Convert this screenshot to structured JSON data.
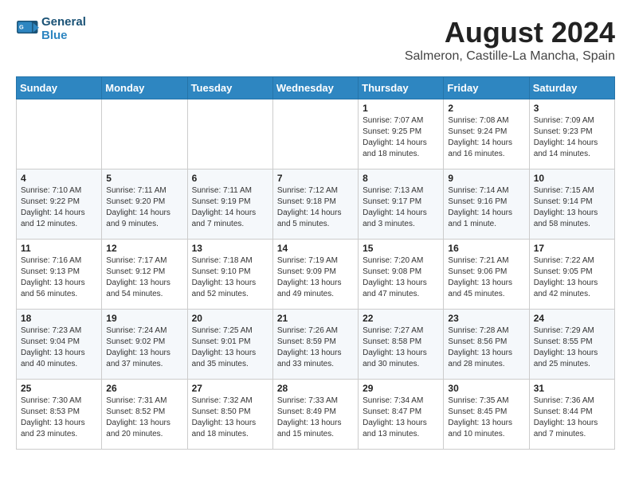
{
  "header": {
    "logo_line1": "General",
    "logo_line2": "Blue",
    "title": "August 2024",
    "subtitle": "Salmeron, Castille-La Mancha, Spain"
  },
  "weekdays": [
    "Sunday",
    "Monday",
    "Tuesday",
    "Wednesday",
    "Thursday",
    "Friday",
    "Saturday"
  ],
  "weeks": [
    [
      {
        "day": "",
        "info": ""
      },
      {
        "day": "",
        "info": ""
      },
      {
        "day": "",
        "info": ""
      },
      {
        "day": "",
        "info": ""
      },
      {
        "day": "1",
        "info": "Sunrise: 7:07 AM\nSunset: 9:25 PM\nDaylight: 14 hours\nand 18 minutes."
      },
      {
        "day": "2",
        "info": "Sunrise: 7:08 AM\nSunset: 9:24 PM\nDaylight: 14 hours\nand 16 minutes."
      },
      {
        "day": "3",
        "info": "Sunrise: 7:09 AM\nSunset: 9:23 PM\nDaylight: 14 hours\nand 14 minutes."
      }
    ],
    [
      {
        "day": "4",
        "info": "Sunrise: 7:10 AM\nSunset: 9:22 PM\nDaylight: 14 hours\nand 12 minutes."
      },
      {
        "day": "5",
        "info": "Sunrise: 7:11 AM\nSunset: 9:20 PM\nDaylight: 14 hours\nand 9 minutes."
      },
      {
        "day": "6",
        "info": "Sunrise: 7:11 AM\nSunset: 9:19 PM\nDaylight: 14 hours\nand 7 minutes."
      },
      {
        "day": "7",
        "info": "Sunrise: 7:12 AM\nSunset: 9:18 PM\nDaylight: 14 hours\nand 5 minutes."
      },
      {
        "day": "8",
        "info": "Sunrise: 7:13 AM\nSunset: 9:17 PM\nDaylight: 14 hours\nand 3 minutes."
      },
      {
        "day": "9",
        "info": "Sunrise: 7:14 AM\nSunset: 9:16 PM\nDaylight: 14 hours\nand 1 minute."
      },
      {
        "day": "10",
        "info": "Sunrise: 7:15 AM\nSunset: 9:14 PM\nDaylight: 13 hours\nand 58 minutes."
      }
    ],
    [
      {
        "day": "11",
        "info": "Sunrise: 7:16 AM\nSunset: 9:13 PM\nDaylight: 13 hours\nand 56 minutes."
      },
      {
        "day": "12",
        "info": "Sunrise: 7:17 AM\nSunset: 9:12 PM\nDaylight: 13 hours\nand 54 minutes."
      },
      {
        "day": "13",
        "info": "Sunrise: 7:18 AM\nSunset: 9:10 PM\nDaylight: 13 hours\nand 52 minutes."
      },
      {
        "day": "14",
        "info": "Sunrise: 7:19 AM\nSunset: 9:09 PM\nDaylight: 13 hours\nand 49 minutes."
      },
      {
        "day": "15",
        "info": "Sunrise: 7:20 AM\nSunset: 9:08 PM\nDaylight: 13 hours\nand 47 minutes."
      },
      {
        "day": "16",
        "info": "Sunrise: 7:21 AM\nSunset: 9:06 PM\nDaylight: 13 hours\nand 45 minutes."
      },
      {
        "day": "17",
        "info": "Sunrise: 7:22 AM\nSunset: 9:05 PM\nDaylight: 13 hours\nand 42 minutes."
      }
    ],
    [
      {
        "day": "18",
        "info": "Sunrise: 7:23 AM\nSunset: 9:04 PM\nDaylight: 13 hours\nand 40 minutes."
      },
      {
        "day": "19",
        "info": "Sunrise: 7:24 AM\nSunset: 9:02 PM\nDaylight: 13 hours\nand 37 minutes."
      },
      {
        "day": "20",
        "info": "Sunrise: 7:25 AM\nSunset: 9:01 PM\nDaylight: 13 hours\nand 35 minutes."
      },
      {
        "day": "21",
        "info": "Sunrise: 7:26 AM\nSunset: 8:59 PM\nDaylight: 13 hours\nand 33 minutes."
      },
      {
        "day": "22",
        "info": "Sunrise: 7:27 AM\nSunset: 8:58 PM\nDaylight: 13 hours\nand 30 minutes."
      },
      {
        "day": "23",
        "info": "Sunrise: 7:28 AM\nSunset: 8:56 PM\nDaylight: 13 hours\nand 28 minutes."
      },
      {
        "day": "24",
        "info": "Sunrise: 7:29 AM\nSunset: 8:55 PM\nDaylight: 13 hours\nand 25 minutes."
      }
    ],
    [
      {
        "day": "25",
        "info": "Sunrise: 7:30 AM\nSunset: 8:53 PM\nDaylight: 13 hours\nand 23 minutes."
      },
      {
        "day": "26",
        "info": "Sunrise: 7:31 AM\nSunset: 8:52 PM\nDaylight: 13 hours\nand 20 minutes."
      },
      {
        "day": "27",
        "info": "Sunrise: 7:32 AM\nSunset: 8:50 PM\nDaylight: 13 hours\nand 18 minutes."
      },
      {
        "day": "28",
        "info": "Sunrise: 7:33 AM\nSunset: 8:49 PM\nDaylight: 13 hours\nand 15 minutes."
      },
      {
        "day": "29",
        "info": "Sunrise: 7:34 AM\nSunset: 8:47 PM\nDaylight: 13 hours\nand 13 minutes."
      },
      {
        "day": "30",
        "info": "Sunrise: 7:35 AM\nSunset: 8:45 PM\nDaylight: 13 hours\nand 10 minutes."
      },
      {
        "day": "31",
        "info": "Sunrise: 7:36 AM\nSunset: 8:44 PM\nDaylight: 13 hours\nand 7 minutes."
      }
    ]
  ]
}
